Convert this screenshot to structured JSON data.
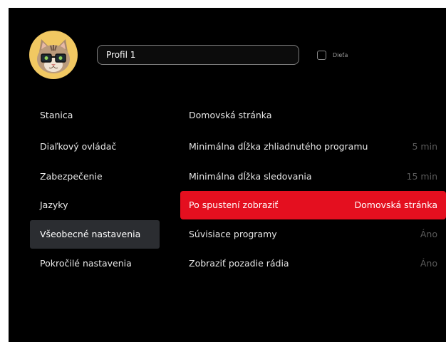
{
  "colors": {
    "background": "#000000",
    "accent": "#e40f1f",
    "menu_active": "#2b2d31",
    "avatar_bg": "#f1c862"
  },
  "profile": {
    "avatar_icon": "cat-with-glasses-avatar",
    "name_value": "Profil 1",
    "kid_label": "Dieťa",
    "kid_checked": false
  },
  "menu": {
    "items": [
      {
        "label": "Stanica",
        "active": false
      },
      {
        "label": "Diaľkový ovládač",
        "active": false
      },
      {
        "label": "Zabezpečenie",
        "active": false
      },
      {
        "label": "Jazyky",
        "active": false
      },
      {
        "label": "Všeobecné nastavenia",
        "active": true
      },
      {
        "label": "Pokročilé nastavenia",
        "active": false
      }
    ]
  },
  "settings": {
    "rows": [
      {
        "label": "Domovská stránka",
        "value": ""
      },
      {
        "label": "Minimálna dĺžka zhliadnutého programu",
        "value": "5 min"
      },
      {
        "label": "Minimálna dĺžka sledovania",
        "value": "15 min"
      },
      {
        "label": "Po spustení zobraziť",
        "value": "Domovská stránka",
        "active": true
      },
      {
        "label": "Súvisiace programy",
        "value": "Áno"
      },
      {
        "label": "Zobraziť pozadie rádia",
        "value": "Áno"
      }
    ]
  }
}
